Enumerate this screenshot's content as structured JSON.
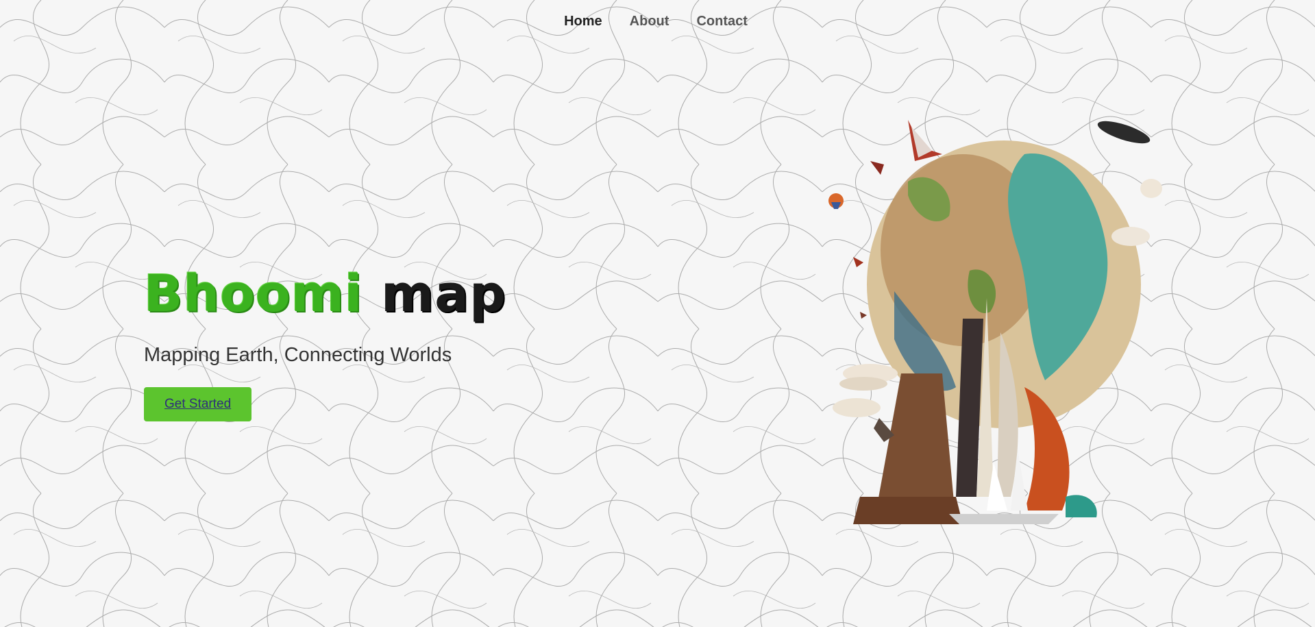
{
  "nav": {
    "items": [
      {
        "label": "Home",
        "active": true
      },
      {
        "label": "About",
        "active": false
      },
      {
        "label": "Contact",
        "active": false
      }
    ]
  },
  "hero": {
    "title_part1": "Bhoomi",
    "title_part2": "map",
    "tagline": "Mapping Earth, Connecting Worlds",
    "cta_label": "Get Started"
  },
  "colors": {
    "background": "#f6f6f6",
    "accent_green": "#5cc42e",
    "title_green": "#3bb21f",
    "title_dark": "#1a1a1a"
  },
  "illustration": {
    "name": "globe-collage-illustration"
  }
}
